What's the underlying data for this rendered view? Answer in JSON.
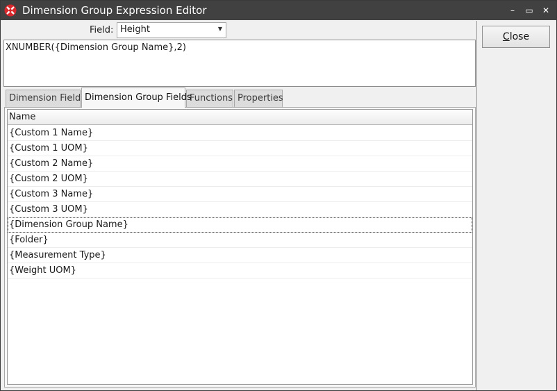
{
  "window": {
    "title": "Dimension Group Expression Editor",
    "icon": "app-logo-icon",
    "controls": {
      "minimize": "–",
      "maximize": "▭",
      "close": "✕"
    }
  },
  "field": {
    "label": "Field:",
    "selected_value": "Height"
  },
  "expression": {
    "value": "XNUMBER({Dimension Group Name},2)"
  },
  "tabs": [
    {
      "label": "Dimension Fields",
      "active": false
    },
    {
      "label": "Dimension Group Fields",
      "active": true
    },
    {
      "label": "Functions",
      "active": false
    },
    {
      "label": "Properties",
      "active": false
    }
  ],
  "grid": {
    "column_header": "Name",
    "rows": [
      "{Custom 1 Name}",
      "{Custom 1 UOM}",
      "{Custom 2 Name}",
      "{Custom 2 UOM}",
      "{Custom 3 Name}",
      "{Custom 3 UOM}",
      "{Dimension Group Name}",
      "{Folder}",
      "{Measurement Type}",
      "{Weight UOM}"
    ],
    "selected_row": "{Dimension Group Name}"
  },
  "actions": {
    "close_first": "C",
    "close_rest": "lose"
  },
  "colors": {
    "titlebar": "#414141",
    "window_bg": "#f0f0f0",
    "icon_red": "#d9262b"
  }
}
